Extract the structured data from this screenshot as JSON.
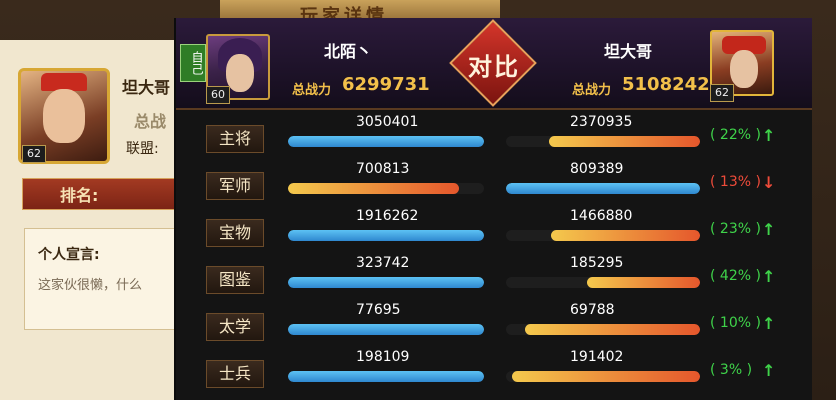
{
  "background": {
    "title": "玩家详情",
    "player_name": "坦大哥",
    "power_label": "总战",
    "alliance_label": "联盟:",
    "rank_label": "排名:",
    "declaration_title": "个人宣言:",
    "declaration_text": "这家伙很懒，什么",
    "level": "62"
  },
  "compare": {
    "self_tag": "自己",
    "title": "对比",
    "left": {
      "name": "北陌丶",
      "power_label": "总战力",
      "power": "6299731",
      "level": "60"
    },
    "right": {
      "name": "坦大哥",
      "power_label": "总战力",
      "power": "5108242",
      "level": "62"
    },
    "rows": [
      {
        "label": "主将",
        "left": "3050401",
        "right": "2370935",
        "pct": "( 22% )",
        "dir": "up",
        "arrow": "↑",
        "left_fill": 1.0,
        "right_fill": 0.78,
        "left_color": "blue",
        "right_color": "warm"
      },
      {
        "label": "军师",
        "left": "700813",
        "right": "809389",
        "pct": "( 13% )",
        "dir": "down",
        "arrow": "↓",
        "left_fill": 0.87,
        "right_fill": 1.0,
        "left_color": "warm",
        "right_color": "blue"
      },
      {
        "label": "宝物",
        "left": "1916262",
        "right": "1466880",
        "pct": "( 23% )",
        "dir": "up",
        "arrow": "↑",
        "left_fill": 1.0,
        "right_fill": 0.77,
        "left_color": "blue",
        "right_color": "warm"
      },
      {
        "label": "图鉴",
        "left": "323742",
        "right": "185295",
        "pct": "( 42% )",
        "dir": "up",
        "arrow": "↑",
        "left_fill": 1.0,
        "right_fill": 0.58,
        "left_color": "blue",
        "right_color": "warm"
      },
      {
        "label": "太学",
        "left": "77695",
        "right": "69788",
        "pct": "( 10% )",
        "dir": "up",
        "arrow": "↑",
        "left_fill": 1.0,
        "right_fill": 0.9,
        "left_color": "blue",
        "right_color": "warm"
      },
      {
        "label": "士兵",
        "left": "198109",
        "right": "191402",
        "pct": "( 3% )",
        "dir": "up",
        "arrow": "↑",
        "left_fill": 1.0,
        "right_fill": 0.97,
        "left_color": "blue",
        "right_color": "warm"
      }
    ]
  }
}
